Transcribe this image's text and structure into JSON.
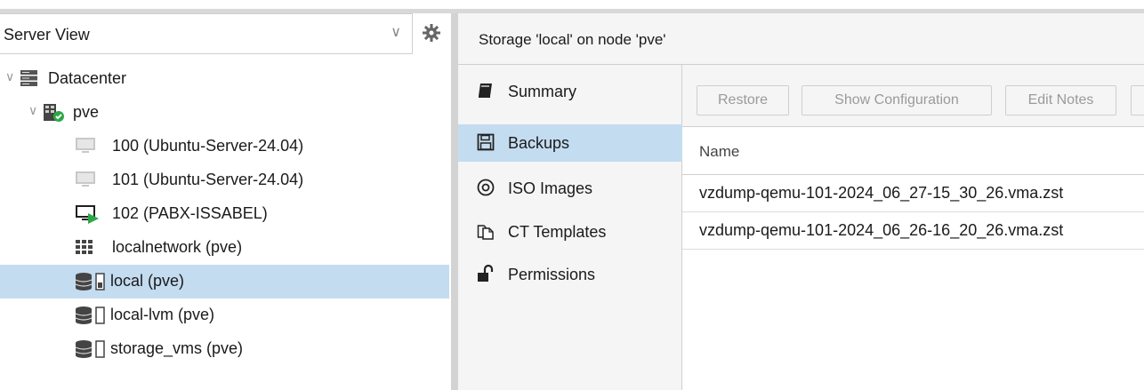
{
  "view_selector": {
    "label": "Server View"
  },
  "tree": {
    "datacenter": "Datacenter",
    "node": "pve",
    "items": [
      {
        "label": "100 (Ubuntu-Server-24.04)",
        "icon": "vm-stopped-icon"
      },
      {
        "label": "101 (Ubuntu-Server-24.04)",
        "icon": "vm-stopped-icon"
      },
      {
        "label": "102 (PABX-ISSABEL)",
        "icon": "vm-running-icon"
      },
      {
        "label": "localnetwork (pve)",
        "icon": "network-icon"
      },
      {
        "label": "local (pve)",
        "icon": "storage-icon",
        "selected": true
      },
      {
        "label": "local-lvm (pve)",
        "icon": "storage-icon"
      },
      {
        "label": "storage_vms (pve)",
        "icon": "storage-icon"
      }
    ]
  },
  "header": {
    "title": "Storage 'local' on node 'pve'"
  },
  "subnav": {
    "items": [
      {
        "label": "Summary",
        "icon": "book-icon"
      },
      {
        "label": "Backups",
        "icon": "floppy-icon",
        "active": true
      },
      {
        "label": "ISO Images",
        "icon": "disc-icon"
      },
      {
        "label": "CT Templates",
        "icon": "template-icon"
      },
      {
        "label": "Permissions",
        "icon": "unlock-icon"
      }
    ]
  },
  "toolbar": {
    "restore": "Restore",
    "show_config": "Show Configuration",
    "edit_notes": "Edit Notes"
  },
  "grid": {
    "column_name": "Name",
    "rows": [
      "vzdump-qemu-101-2024_06_27-15_30_26.vma.zst",
      "vzdump-qemu-101-2024_06_26-16_20_26.vma.zst"
    ]
  },
  "colors": {
    "selection": "#c4dcf0",
    "panel_bg": "#f5f5f5",
    "running_green": "#2aa845"
  }
}
